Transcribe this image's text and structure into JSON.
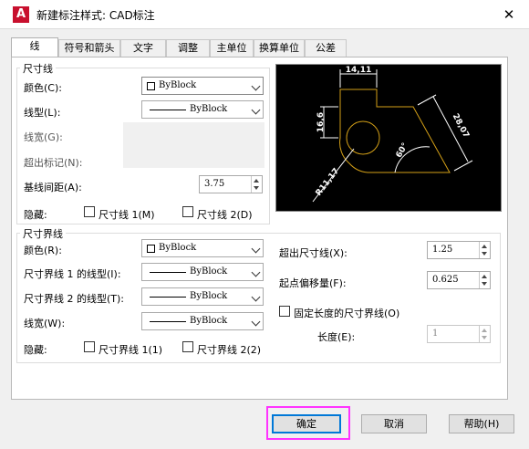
{
  "window": {
    "title": "新建标注样式: CAD标注",
    "close_label": "✕",
    "app_logo_letter": "A"
  },
  "tabs": [
    {
      "label": "线",
      "active": true
    },
    {
      "label": "符号和箭头"
    },
    {
      "label": "文字"
    },
    {
      "label": "调整"
    },
    {
      "label": "主单位"
    },
    {
      "label": "换算单位"
    },
    {
      "label": "公差"
    }
  ],
  "dim_lines": {
    "group_title": "尺寸线",
    "color_label": "颜色(C):",
    "color_value": "ByBlock",
    "linetype_label": "线型(L):",
    "linetype_value": "ByBlock",
    "lineweight_label": "线宽(G):",
    "extend_ticks_label": "超出标记(N):",
    "baseline_spacing_label": "基线间距(A):",
    "baseline_spacing_value": "3.75",
    "suppress_label": "隐藏:",
    "suppress_1_label": "尺寸线 1(M)",
    "suppress_2_label": "尺寸线 2(D)"
  },
  "ext_lines": {
    "group_title": "尺寸界线",
    "color_label": "颜色(R):",
    "color_value": "ByBlock",
    "linetype1_label": "尺寸界线 1 的线型(I):",
    "linetype1_value": "ByBlock",
    "linetype2_label": "尺寸界线 2 的线型(T):",
    "linetype2_value": "ByBlock",
    "lineweight_label": "线宽(W):",
    "lineweight_value": "ByBlock",
    "suppress_label": "隐藏:",
    "suppress_1_label": "尺寸界线 1(1)",
    "suppress_2_label": "尺寸界线 2(2)",
    "extend_beyond_label": "超出尺寸线(X):",
    "extend_beyond_value": "1.25",
    "offset_label": "起点偏移量(F):",
    "offset_value": "0.625",
    "fixed_length_label": "固定长度的尺寸界线(O)",
    "length_label": "长度(E):",
    "length_value": "1"
  },
  "preview": {
    "dim_top": "14,11",
    "dim_left": "16,6",
    "dim_right": "28,07",
    "dim_angle": "60°",
    "dim_radius": "R11,17"
  },
  "buttons": {
    "ok": "确定",
    "cancel": "取消",
    "help": "帮助(H)"
  },
  "colors": {
    "accent": "#0078d7",
    "highlight": "#ff33ff",
    "preview_bg": "#000000",
    "preview_shape": "#d4a017",
    "logo": "#c8102e"
  }
}
